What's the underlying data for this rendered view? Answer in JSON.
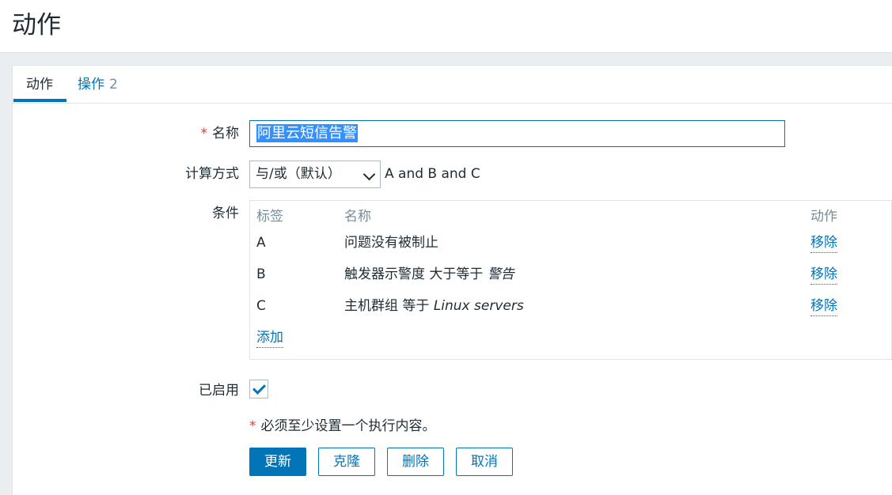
{
  "header": {
    "title": "动作"
  },
  "tabs": [
    {
      "label": "动作",
      "active": true
    },
    {
      "label": "操作",
      "count": "2",
      "active": false
    }
  ],
  "form": {
    "name": {
      "label": "名称",
      "required_mark": "*",
      "value": "阿里云短信告警"
    },
    "calc": {
      "label": "计算方式",
      "selected": "与/或（默认）",
      "formula": "A and B and C"
    },
    "conditions": {
      "label": "条件",
      "headers": [
        "标签",
        "名称",
        "动作"
      ],
      "rows": [
        {
          "tag": "A",
          "name_prefix": "问题没有被制止",
          "name_value": "",
          "action": "移除"
        },
        {
          "tag": "B",
          "name_prefix": "触发器示警度 大于等于",
          "name_value": "警告",
          "action": "移除"
        },
        {
          "tag": "C",
          "name_prefix": "主机群组 等于",
          "name_value": "Linux servers",
          "action": "移除"
        }
      ],
      "add_label": "添加"
    },
    "enabled": {
      "label": "已启用",
      "checked": true
    },
    "note": {
      "mark": "*",
      "text": "必须至少设置一个执行内容。"
    }
  },
  "buttons": {
    "update": "更新",
    "clone": "克隆",
    "delete": "删除",
    "cancel": "取消"
  },
  "colors": {
    "accent": "#0275b8",
    "required": "#e33734",
    "muted": "#768d99"
  }
}
